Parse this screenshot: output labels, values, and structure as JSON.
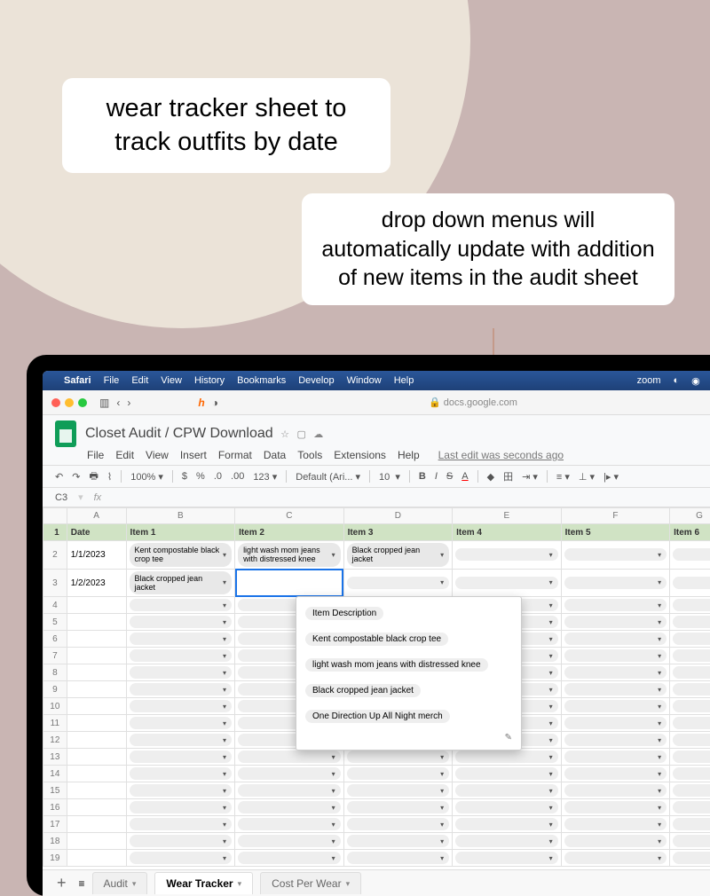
{
  "captions": {
    "c1": "wear tracker sheet to track outfits by date",
    "c2": "drop down menus will automatically update with addition of new items in the audit sheet"
  },
  "menubar": {
    "app": "Safari",
    "items": [
      "File",
      "Edit",
      "View",
      "History",
      "Bookmarks",
      "Develop",
      "Window",
      "Help"
    ],
    "right": "zoom"
  },
  "browser": {
    "url": "docs.google.com"
  },
  "doc": {
    "title": "Closet Audit / CPW Download",
    "menus": [
      "File",
      "Edit",
      "View",
      "Insert",
      "Format",
      "Data",
      "Tools",
      "Extensions",
      "Help"
    ],
    "last_edit": "Last edit was seconds ago"
  },
  "fmt": {
    "zoom": "100%",
    "font": "Default (Ari...",
    "size": "10",
    "symbols": [
      "$",
      "%",
      ".0",
      ".00",
      "123"
    ]
  },
  "cellref": "C3",
  "columns": [
    "",
    "A",
    "B",
    "C",
    "D",
    "E",
    "F",
    "G"
  ],
  "headers": [
    "Date",
    "Item 1",
    "Item 2",
    "Item 3",
    "Item 4",
    "Item 5",
    "Item 6"
  ],
  "rows": [
    {
      "n": "1"
    },
    {
      "n": "2",
      "date": "1/1/2023",
      "cells": [
        "Kent compostable black crop tee",
        "light wash mom jeans with distressed knee",
        "Black cropped jean jacket",
        "",
        "",
        ""
      ]
    },
    {
      "n": "3",
      "date": "1/2/2023",
      "cells": [
        "Black cropped jean jacket",
        "",
        "",
        "",
        "",
        ""
      ],
      "active": 1
    },
    {
      "n": "4"
    },
    {
      "n": "5"
    },
    {
      "n": "6"
    },
    {
      "n": "7"
    },
    {
      "n": "8"
    },
    {
      "n": "9"
    },
    {
      "n": "10"
    },
    {
      "n": "11"
    },
    {
      "n": "12"
    },
    {
      "n": "13"
    },
    {
      "n": "14"
    },
    {
      "n": "15"
    },
    {
      "n": "16"
    },
    {
      "n": "17"
    },
    {
      "n": "18"
    },
    {
      "n": "19"
    }
  ],
  "dropdown": [
    "Item Description",
    "Kent compostable black crop tee",
    "light wash mom jeans with distressed knee",
    "Black cropped jean jacket",
    "One Direction Up All Night merch"
  ],
  "tabs": {
    "audit": "Audit",
    "tracker": "Wear Tracker",
    "cpw": "Cost Per Wear"
  }
}
